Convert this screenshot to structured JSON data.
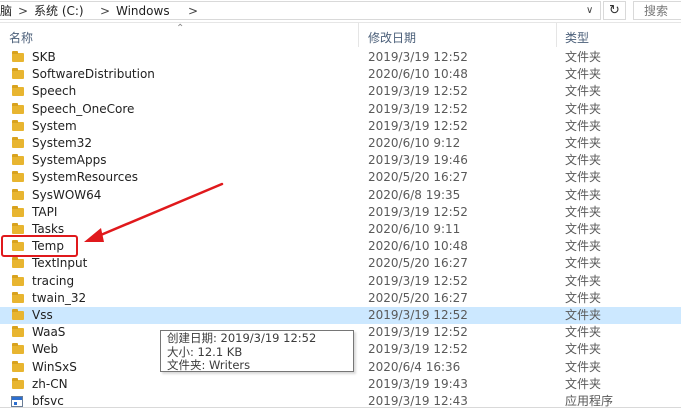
{
  "address": {
    "crumbs": [
      "脑",
      "系统 (C:)",
      "Windows"
    ],
    "refresh_icon": "refresh-icon",
    "search_placeholder": "搜索"
  },
  "columns": {
    "name": "名称",
    "date": "修改日期",
    "type": "类型"
  },
  "rows": [
    {
      "name": "SKB",
      "date": "2019/3/19 12:52",
      "type": "文件夹",
      "icon": "folder"
    },
    {
      "name": "SoftwareDistribution",
      "date": "2020/6/10 10:48",
      "type": "文件夹",
      "icon": "folder"
    },
    {
      "name": "Speech",
      "date": "2019/3/19 12:52",
      "type": "文件夹",
      "icon": "folder"
    },
    {
      "name": "Speech_OneCore",
      "date": "2019/3/19 12:52",
      "type": "文件夹",
      "icon": "folder"
    },
    {
      "name": "System",
      "date": "2019/3/19 12:52",
      "type": "文件夹",
      "icon": "folder"
    },
    {
      "name": "System32",
      "date": "2020/6/10 9:12",
      "type": "文件夹",
      "icon": "folder"
    },
    {
      "name": "SystemApps",
      "date": "2019/3/19 19:46",
      "type": "文件夹",
      "icon": "folder"
    },
    {
      "name": "SystemResources",
      "date": "2020/5/20 16:27",
      "type": "文件夹",
      "icon": "folder"
    },
    {
      "name": "SysWOW64",
      "date": "2020/6/8 19:35",
      "type": "文件夹",
      "icon": "folder"
    },
    {
      "name": "TAPI",
      "date": "2019/3/19 12:52",
      "type": "文件夹",
      "icon": "folder"
    },
    {
      "name": "Tasks",
      "date": "2020/6/10 9:11",
      "type": "文件夹",
      "icon": "folder"
    },
    {
      "name": "Temp",
      "date": "2020/6/10 10:48",
      "type": "文件夹",
      "icon": "folder"
    },
    {
      "name": "TextInput",
      "date": "2020/5/20 16:27",
      "type": "文件夹",
      "icon": "folder"
    },
    {
      "name": "tracing",
      "date": "2019/3/19 12:52",
      "type": "文件夹",
      "icon": "folder"
    },
    {
      "name": "twain_32",
      "date": "2020/5/20 16:27",
      "type": "文件夹",
      "icon": "folder"
    },
    {
      "name": "Vss",
      "date": "2019/3/19 12:52",
      "type": "文件夹",
      "icon": "folder",
      "selected": true
    },
    {
      "name": "WaaS",
      "date": "2019/3/19 12:52",
      "type": "文件夹",
      "icon": "folder"
    },
    {
      "name": "Web",
      "date": "2019/3/19 12:52",
      "type": "文件夹",
      "icon": "folder"
    },
    {
      "name": "WinSxS",
      "date": "2020/6/4 16:36",
      "type": "文件夹",
      "icon": "folder"
    },
    {
      "name": "zh-CN",
      "date": "2019/3/19 19:43",
      "type": "文件夹",
      "icon": "folder"
    },
    {
      "name": "bfsvc",
      "date": "2019/3/19 12:43",
      "type": "应用程序",
      "icon": "application"
    }
  ],
  "tooltip": {
    "created": "创建日期: 2019/3/19 12:52",
    "size": "大小: 12.1 KB",
    "folder": "文件夹: Writers"
  },
  "annotation": {
    "color": "#e0191c",
    "highlighted_row": "Temp"
  },
  "colors": {
    "selection": "#cce8ff",
    "folder": "#e8b530",
    "header_text": "#4c607a"
  }
}
